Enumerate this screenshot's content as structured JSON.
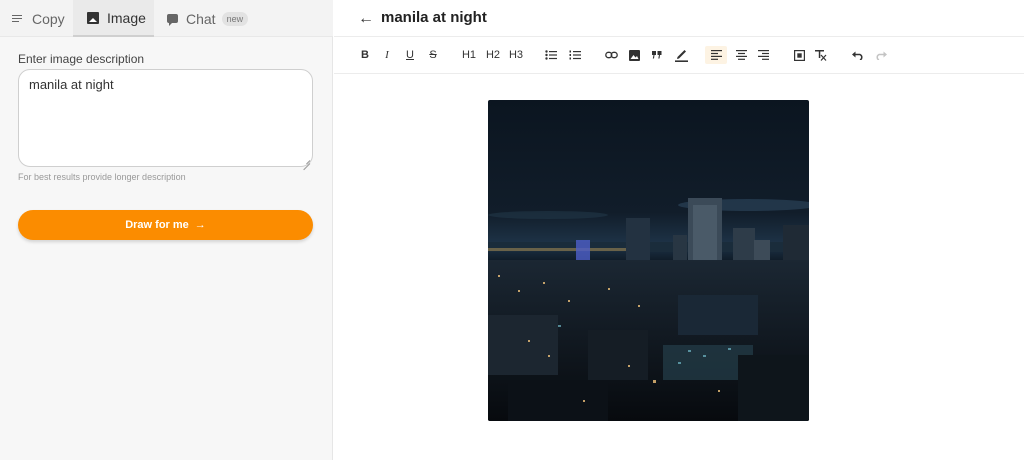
{
  "tabs": [
    {
      "label": "Copy"
    },
    {
      "label": "Image"
    },
    {
      "label": "Chat",
      "badge": "new"
    }
  ],
  "form": {
    "label": "Enter image description",
    "value": "manila at night",
    "hint": "For best results provide longer description",
    "button_label": "Draw for me",
    "button_arrow": "→"
  },
  "editor": {
    "title": "manila at night",
    "back_glyph": "←"
  },
  "toolbar": {
    "bold": "B",
    "italic": "I",
    "underline": "U",
    "strike": "S",
    "h1": "H1",
    "h2": "H2",
    "h3": "H3"
  },
  "colors": {
    "accent": "#fb8c00",
    "active_bg": "#fdf3e3"
  }
}
